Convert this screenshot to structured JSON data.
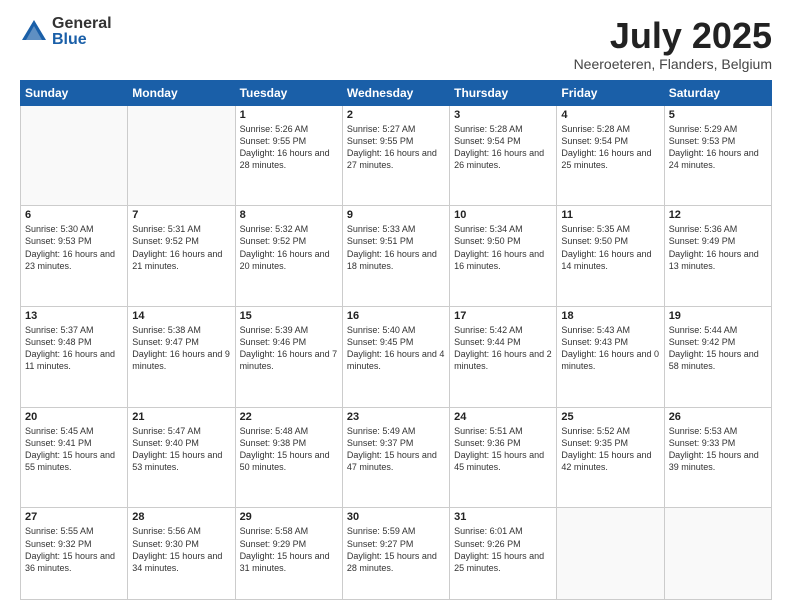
{
  "logo": {
    "general": "General",
    "blue": "Blue"
  },
  "title": {
    "month_year": "July 2025",
    "location": "Neeroeteren, Flanders, Belgium"
  },
  "days_of_week": [
    "Sunday",
    "Monday",
    "Tuesday",
    "Wednesday",
    "Thursday",
    "Friday",
    "Saturday"
  ],
  "weeks": [
    [
      {
        "day": "",
        "empty": true
      },
      {
        "day": "",
        "empty": true
      },
      {
        "day": "1",
        "sunrise": "Sunrise: 5:26 AM",
        "sunset": "Sunset: 9:55 PM",
        "daylight": "Daylight: 16 hours and 28 minutes."
      },
      {
        "day": "2",
        "sunrise": "Sunrise: 5:27 AM",
        "sunset": "Sunset: 9:55 PM",
        "daylight": "Daylight: 16 hours and 27 minutes."
      },
      {
        "day": "3",
        "sunrise": "Sunrise: 5:28 AM",
        "sunset": "Sunset: 9:54 PM",
        "daylight": "Daylight: 16 hours and 26 minutes."
      },
      {
        "day": "4",
        "sunrise": "Sunrise: 5:28 AM",
        "sunset": "Sunset: 9:54 PM",
        "daylight": "Daylight: 16 hours and 25 minutes."
      },
      {
        "day": "5",
        "sunrise": "Sunrise: 5:29 AM",
        "sunset": "Sunset: 9:53 PM",
        "daylight": "Daylight: 16 hours and 24 minutes."
      }
    ],
    [
      {
        "day": "6",
        "sunrise": "Sunrise: 5:30 AM",
        "sunset": "Sunset: 9:53 PM",
        "daylight": "Daylight: 16 hours and 23 minutes."
      },
      {
        "day": "7",
        "sunrise": "Sunrise: 5:31 AM",
        "sunset": "Sunset: 9:52 PM",
        "daylight": "Daylight: 16 hours and 21 minutes."
      },
      {
        "day": "8",
        "sunrise": "Sunrise: 5:32 AM",
        "sunset": "Sunset: 9:52 PM",
        "daylight": "Daylight: 16 hours and 20 minutes."
      },
      {
        "day": "9",
        "sunrise": "Sunrise: 5:33 AM",
        "sunset": "Sunset: 9:51 PM",
        "daylight": "Daylight: 16 hours and 18 minutes."
      },
      {
        "day": "10",
        "sunrise": "Sunrise: 5:34 AM",
        "sunset": "Sunset: 9:50 PM",
        "daylight": "Daylight: 16 hours and 16 minutes."
      },
      {
        "day": "11",
        "sunrise": "Sunrise: 5:35 AM",
        "sunset": "Sunset: 9:50 PM",
        "daylight": "Daylight: 16 hours and 14 minutes."
      },
      {
        "day": "12",
        "sunrise": "Sunrise: 5:36 AM",
        "sunset": "Sunset: 9:49 PM",
        "daylight": "Daylight: 16 hours and 13 minutes."
      }
    ],
    [
      {
        "day": "13",
        "sunrise": "Sunrise: 5:37 AM",
        "sunset": "Sunset: 9:48 PM",
        "daylight": "Daylight: 16 hours and 11 minutes."
      },
      {
        "day": "14",
        "sunrise": "Sunrise: 5:38 AM",
        "sunset": "Sunset: 9:47 PM",
        "daylight": "Daylight: 16 hours and 9 minutes."
      },
      {
        "day": "15",
        "sunrise": "Sunrise: 5:39 AM",
        "sunset": "Sunset: 9:46 PM",
        "daylight": "Daylight: 16 hours and 7 minutes."
      },
      {
        "day": "16",
        "sunrise": "Sunrise: 5:40 AM",
        "sunset": "Sunset: 9:45 PM",
        "daylight": "Daylight: 16 hours and 4 minutes."
      },
      {
        "day": "17",
        "sunrise": "Sunrise: 5:42 AM",
        "sunset": "Sunset: 9:44 PM",
        "daylight": "Daylight: 16 hours and 2 minutes."
      },
      {
        "day": "18",
        "sunrise": "Sunrise: 5:43 AM",
        "sunset": "Sunset: 9:43 PM",
        "daylight": "Daylight: 16 hours and 0 minutes."
      },
      {
        "day": "19",
        "sunrise": "Sunrise: 5:44 AM",
        "sunset": "Sunset: 9:42 PM",
        "daylight": "Daylight: 15 hours and 58 minutes."
      }
    ],
    [
      {
        "day": "20",
        "sunrise": "Sunrise: 5:45 AM",
        "sunset": "Sunset: 9:41 PM",
        "daylight": "Daylight: 15 hours and 55 minutes."
      },
      {
        "day": "21",
        "sunrise": "Sunrise: 5:47 AM",
        "sunset": "Sunset: 9:40 PM",
        "daylight": "Daylight: 15 hours and 53 minutes."
      },
      {
        "day": "22",
        "sunrise": "Sunrise: 5:48 AM",
        "sunset": "Sunset: 9:38 PM",
        "daylight": "Daylight: 15 hours and 50 minutes."
      },
      {
        "day": "23",
        "sunrise": "Sunrise: 5:49 AM",
        "sunset": "Sunset: 9:37 PM",
        "daylight": "Daylight: 15 hours and 47 minutes."
      },
      {
        "day": "24",
        "sunrise": "Sunrise: 5:51 AM",
        "sunset": "Sunset: 9:36 PM",
        "daylight": "Daylight: 15 hours and 45 minutes."
      },
      {
        "day": "25",
        "sunrise": "Sunrise: 5:52 AM",
        "sunset": "Sunset: 9:35 PM",
        "daylight": "Daylight: 15 hours and 42 minutes."
      },
      {
        "day": "26",
        "sunrise": "Sunrise: 5:53 AM",
        "sunset": "Sunset: 9:33 PM",
        "daylight": "Daylight: 15 hours and 39 minutes."
      }
    ],
    [
      {
        "day": "27",
        "sunrise": "Sunrise: 5:55 AM",
        "sunset": "Sunset: 9:32 PM",
        "daylight": "Daylight: 15 hours and 36 minutes."
      },
      {
        "day": "28",
        "sunrise": "Sunrise: 5:56 AM",
        "sunset": "Sunset: 9:30 PM",
        "daylight": "Daylight: 15 hours and 34 minutes."
      },
      {
        "day": "29",
        "sunrise": "Sunrise: 5:58 AM",
        "sunset": "Sunset: 9:29 PM",
        "daylight": "Daylight: 15 hours and 31 minutes."
      },
      {
        "day": "30",
        "sunrise": "Sunrise: 5:59 AM",
        "sunset": "Sunset: 9:27 PM",
        "daylight": "Daylight: 15 hours and 28 minutes."
      },
      {
        "day": "31",
        "sunrise": "Sunrise: 6:01 AM",
        "sunset": "Sunset: 9:26 PM",
        "daylight": "Daylight: 15 hours and 25 minutes."
      },
      {
        "day": "",
        "empty": true
      },
      {
        "day": "",
        "empty": true
      }
    ]
  ]
}
